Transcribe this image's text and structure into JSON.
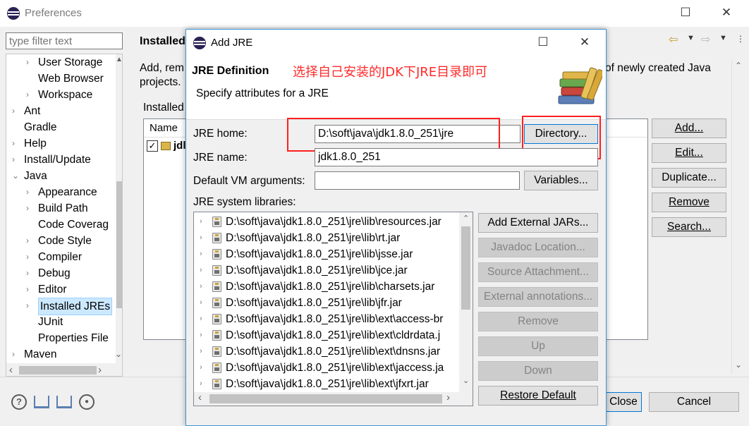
{
  "preferences": {
    "title": "Preferences",
    "filter_placeholder": "type filter text",
    "tree": [
      {
        "label": "User Storage",
        "arrow": "›"
      },
      {
        "label": "Web Browser",
        "arrow": ""
      },
      {
        "label": "Workspace",
        "arrow": "›"
      },
      {
        "label": "Ant",
        "arrow": "›"
      },
      {
        "label": "Gradle",
        "arrow": ""
      },
      {
        "label": "Help",
        "arrow": "›"
      },
      {
        "label": "Install/Update",
        "arrow": "›"
      },
      {
        "label": "Java",
        "arrow": "⌄"
      },
      {
        "label": "Appearance",
        "arrow": "›"
      },
      {
        "label": "Build Path",
        "arrow": "›"
      },
      {
        "label": "Code Coverag",
        "arrow": ""
      },
      {
        "label": "Code Style",
        "arrow": "›"
      },
      {
        "label": "Compiler",
        "arrow": "›"
      },
      {
        "label": "Debug",
        "arrow": "›"
      },
      {
        "label": "Editor",
        "arrow": "›"
      },
      {
        "label": "Installed JREs",
        "arrow": "›"
      },
      {
        "label": "JUnit",
        "arrow": ""
      },
      {
        "label": "Properties File",
        "arrow": ""
      },
      {
        "label": "Maven",
        "arrow": "›"
      }
    ],
    "selected_item": "Installed JREs",
    "page_title": "Installed",
    "desc_line1": "Add, rem",
    "desc_line2": "projects.",
    "desc_right": "of newly created Java",
    "installed_label": "Installed",
    "table_header_name": "Name",
    "table_row_name": "jdl",
    "buttons": {
      "add": "Add...",
      "edit": "Edit...",
      "duplicate": "Duplicate...",
      "remove": "Remove",
      "search": "Search..."
    },
    "close_label": "Close",
    "cancel_label": "Cancel"
  },
  "dialog": {
    "title": "Add JRE",
    "header_title": "JRE Definition",
    "header_note": "选择自己安装的JDK下JRE目录即可",
    "header_desc": "Specify attributes for a JRE",
    "jre_home_label": "JRE home:",
    "jre_home_value": "D:\\soft\\java\\jdk1.8.0_251\\jre",
    "directory_button": "Directory...",
    "jre_name_label": "JRE name:",
    "jre_name_value": "jdk1.8.0_251",
    "vm_args_label": "Default VM arguments:",
    "vm_args_value": "",
    "variables_button": "Variables...",
    "libs_label": "JRE system libraries:",
    "libraries": [
      "D:\\soft\\java\\jdk1.8.0_251\\jre\\lib\\resources.jar",
      "D:\\soft\\java\\jdk1.8.0_251\\jre\\lib\\rt.jar",
      "D:\\soft\\java\\jdk1.8.0_251\\jre\\lib\\jsse.jar",
      "D:\\soft\\java\\jdk1.8.0_251\\jre\\lib\\jce.jar",
      "D:\\soft\\java\\jdk1.8.0_251\\jre\\lib\\charsets.jar",
      "D:\\soft\\java\\jdk1.8.0_251\\jre\\lib\\jfr.jar",
      "D:\\soft\\java\\jdk1.8.0_251\\jre\\lib\\ext\\access-br",
      "D:\\soft\\java\\jdk1.8.0_251\\jre\\lib\\ext\\cldrdata.j",
      "D:\\soft\\java\\jdk1.8.0_251\\jre\\lib\\ext\\dnsns.jar",
      "D:\\soft\\java\\jdk1.8.0_251\\jre\\lib\\ext\\jaccess.ja",
      "D:\\soft\\java\\jdk1.8.0_251\\jre\\lib\\ext\\jfxrt.jar"
    ],
    "lib_buttons": {
      "add_external": "Add External JARs...",
      "javadoc": "Javadoc Location...",
      "source": "Source Attachment...",
      "external_ann": "External annotations...",
      "remove": "Remove",
      "up": "Up",
      "down": "Down",
      "restore": "Restore Default"
    }
  }
}
